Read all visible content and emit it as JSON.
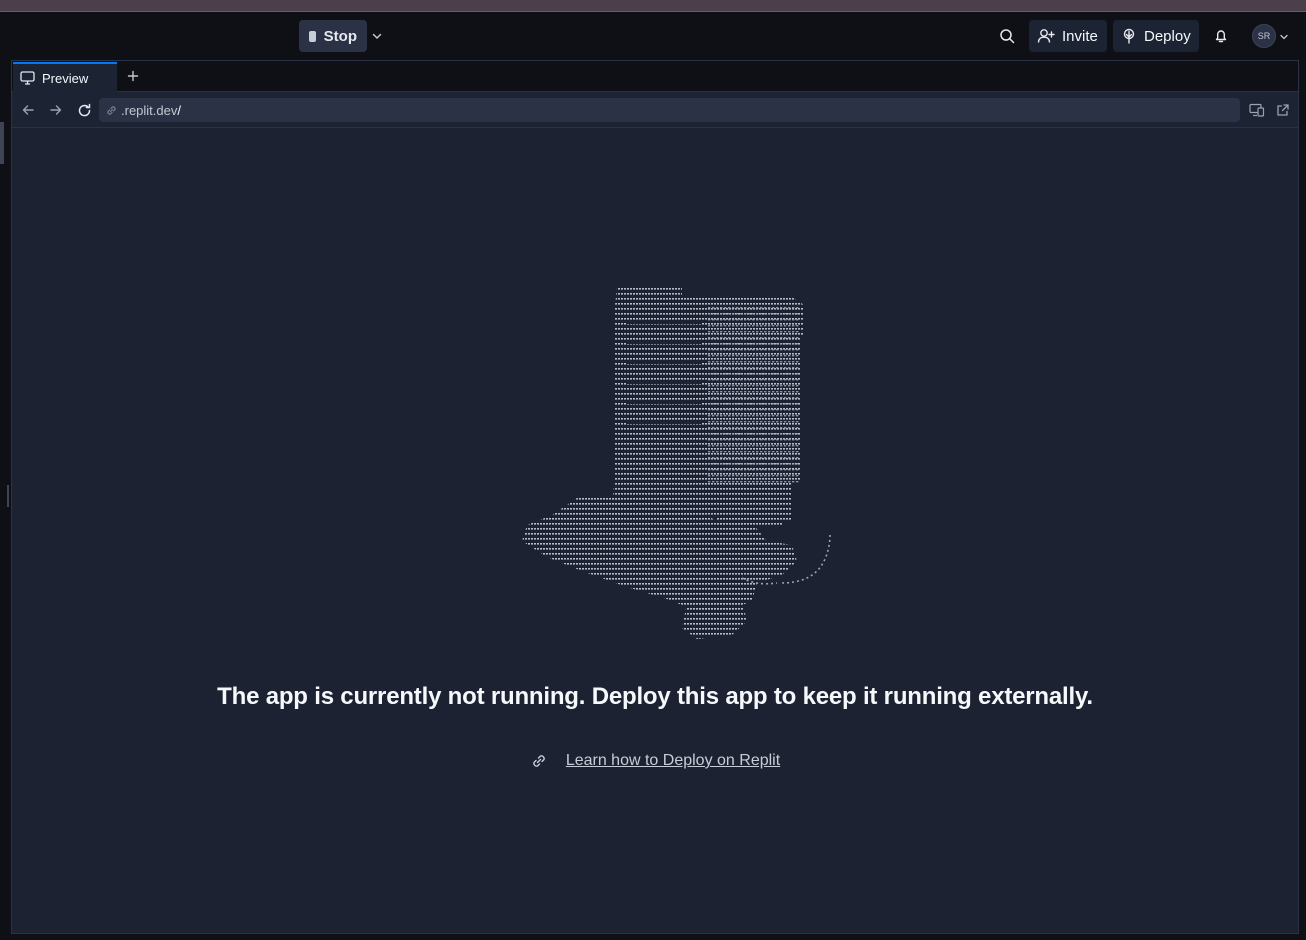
{
  "toolbar": {
    "stop_label": "Stop",
    "invite_label": "Invite",
    "deploy_label": "Deploy",
    "avatar_initials": "SR"
  },
  "tabs": [
    {
      "label": "Preview",
      "icon": "monitor-icon"
    }
  ],
  "urlbar": {
    "url_prefix": ".replit.dev",
    "url_suffix": "/"
  },
  "preview": {
    "headline": "The app is currently not running. Deploy this app to keep it running externally.",
    "learn_link": "Learn how to Deploy on Replit"
  },
  "icons": [
    "search-icon",
    "add-user-icon",
    "deploy-icon",
    "bell-icon",
    "chevron-down-icon",
    "plus-icon",
    "back-arrow-icon",
    "forward-arrow-icon",
    "reload-icon",
    "link-icon",
    "devices-icon",
    "external-link-icon"
  ],
  "colors": {
    "accent": "#0079f2",
    "background": "#0e1015",
    "panel": "#1c2333",
    "button": "#2b3245"
  }
}
